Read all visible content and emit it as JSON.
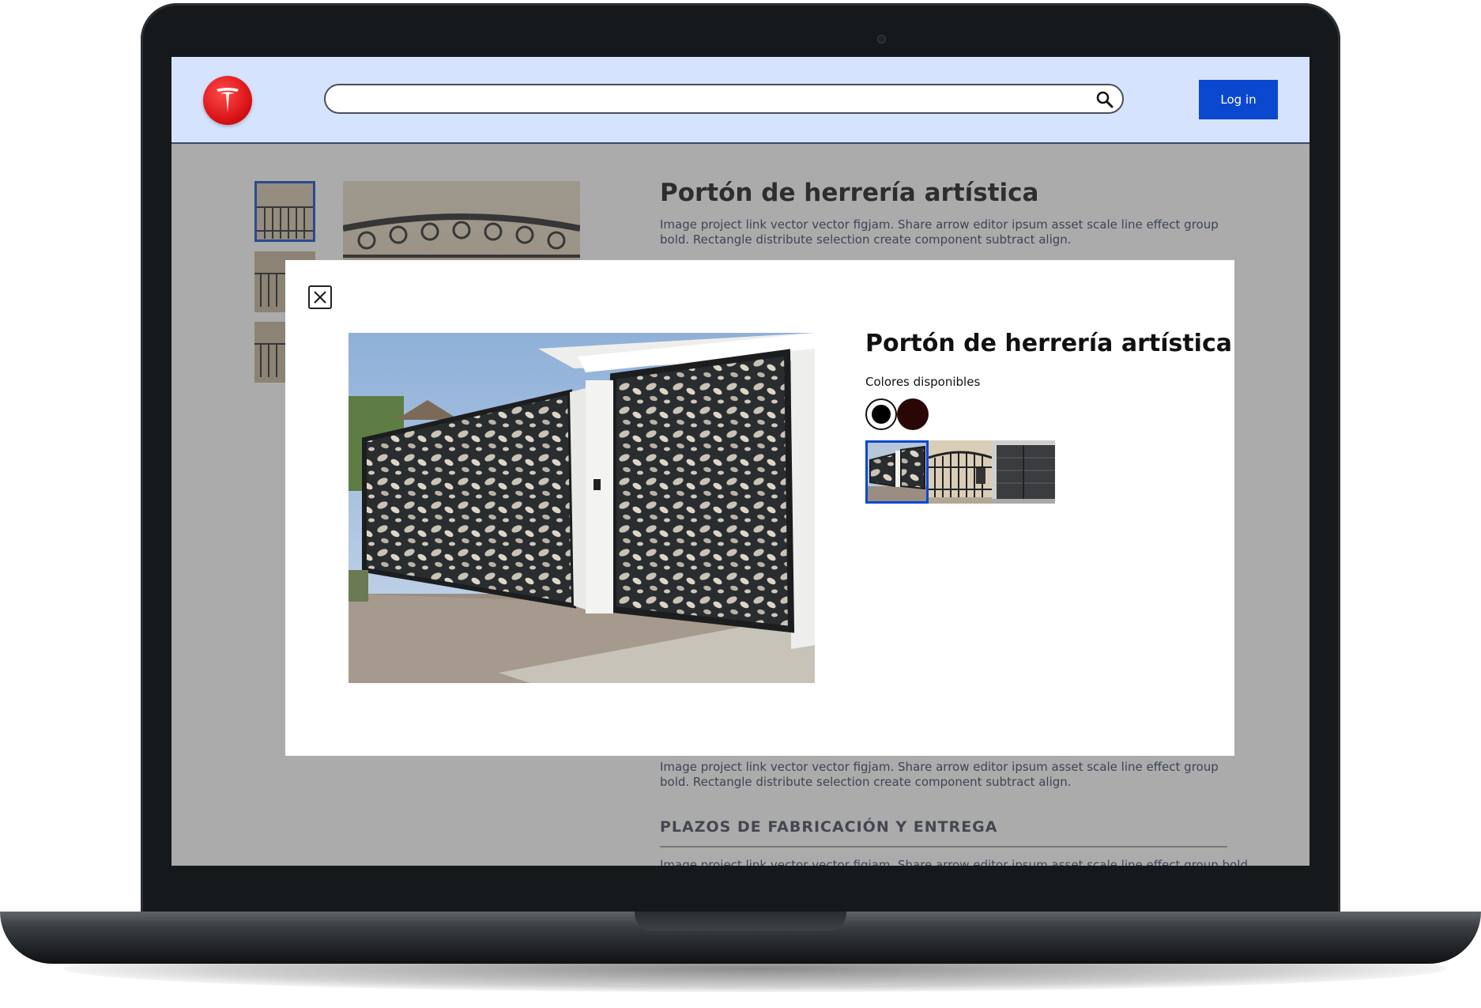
{
  "header": {
    "logo": "tesla-logo",
    "search": {
      "value": "",
      "placeholder": ""
    },
    "login_label": "Log in"
  },
  "product": {
    "title": "Portón de herrería artística",
    "description": "Image project link vector vector figjam. Share arrow editor ipsum asset scale line effect group bold. Rectangle distribute selection create component subtract align.",
    "description_2": "Image project link vector vector figjam. Share arrow editor ipsum asset scale line effect group bold. Rectangle distribute selection create component subtract align.",
    "section_heading": "PLAZOS DE FABRICACIÓN Y ENTREGA"
  },
  "modal": {
    "title": "Portón de herrería artística",
    "colors_label": "Colores disponibles",
    "colors": [
      {
        "name": "black",
        "hex": "#000000",
        "selected": true
      },
      {
        "name": "dark-brown",
        "hex": "#2a0606",
        "selected": false
      }
    ],
    "variants": [
      {
        "name": "laser-cut-gate",
        "selected": true
      },
      {
        "name": "wrought-iron-gate",
        "selected": false
      },
      {
        "name": "horizontal-panel-gate",
        "selected": false
      }
    ]
  },
  "colors": {
    "header_bg": "#d6e3ff",
    "accent": "#0b48d0",
    "overlay": "rgba(80,80,80,0.48)"
  }
}
